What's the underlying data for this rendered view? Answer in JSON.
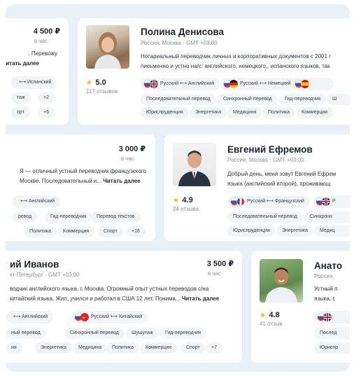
{
  "cards": [
    {
      "id": "partial-top-left",
      "price": "4 500 ₽",
      "per": "в час",
      "desc_lines": [
        ". Перевожу",
        "ь... Читать далее"
      ],
      "langs": [
        {
          "flags": [],
          "label": "⟷ Испанский"
        }
      ],
      "chips_row1": [
        "таж",
        "+2"
      ],
      "chips_row2": [
        "орт",
        "+6"
      ]
    },
    {
      "id": "polina",
      "name": "Полина Денисова",
      "location": "Россия, Москва · GMT +03:00",
      "desc_lines": [
        "Нотариальный переводчик личных и корпоративных документов с 2001 г",
        "письменно и устно на/с: английского, немецкого,, испанского языков, так"
      ],
      "rating": "5.0",
      "reviews": "117 отзывов",
      "langs": [
        {
          "flags": [
            "ru",
            "gb"
          ],
          "label": "Русский ⟷ Английский"
        },
        {
          "flags": [
            "ru",
            "de"
          ],
          "label": "Русский ⟷ Немецкий"
        },
        {
          "flags": [
            "ru",
            "es"
          ],
          "label": ""
        }
      ],
      "chips_row1": [
        "Последовательный перевод",
        "Синхронный перевод",
        "Гид-переводчик",
        "Ш"
      ],
      "chips_row2": [
        "Юриспруденция",
        "Энергетика",
        "Медицина",
        "Политика",
        "Коммерция"
      ]
    },
    {
      "id": "partial-middle-left",
      "price": "3 000 ₽",
      "per": "в час",
      "desc_lines": [
        "Я — отличный устный переводчик французского",
        "Москве. Последовательный и... Читать далее"
      ],
      "langs": [
        {
          "flags": [],
          "label": "⟷ Английский"
        }
      ],
      "chips_row1": [
        "ревод",
        "Гид-переводчик",
        "Перевод текстов"
      ],
      "chips_row2": [
        "Политика",
        "Коммерция",
        "Спорт",
        "+16"
      ]
    },
    {
      "id": "evgeny",
      "name": "Евгений Ефремов",
      "location": "Россия, Москва · GMT +03:00",
      "desc_lines": [
        "Добрый день, меня зовут Евгений Ефрем",
        "языка (английский второй), проживающ"
      ],
      "rating": "4.9",
      "reviews": "24 отзыва",
      "langs": [
        {
          "flags": [
            "ru",
            "fr"
          ],
          "label": "Русский ⟷ Французский"
        },
        {
          "flags": [
            "ru",
            "gb"
          ],
          "label": "Р"
        }
      ],
      "chips_row1": [
        "Последовательный перевод",
        "Синхронн"
      ],
      "chips_row2": [
        "Юриспруденция",
        "Энергетика",
        "Медиц"
      ]
    },
    {
      "id": "ivanov",
      "name": "ий Иванов",
      "location": "кт-Петербург · GMT +03:00",
      "price": "3 500 ₽",
      "per": "в час",
      "desc_lines": [
        "водчик английского языка, г. Москва. Огромный опыт устных переводов с/на",
        "китайский языка. Жил, учился и работал в США 12 лет. Понима... Читать далее"
      ],
      "langs": [
        {
          "flags": [],
          "label": "⟷ Английский"
        },
        {
          "flags": [
            "ru",
            "cn"
          ],
          "label": "Русский ⟷ Китайский"
        }
      ],
      "chips_row1": [
        "ный перевод",
        "Синхронный перевод",
        "Шушутаж",
        "Гид-переводчик"
      ],
      "chips_row2": [
        "ия",
        "Энергетика",
        "Медицина",
        "Политика",
        "Коммерция",
        "Спорт",
        "+7"
      ]
    },
    {
      "id": "anatoly",
      "name": "Анато",
      "location": "Россия, ",
      "desc_lines": [
        "Устный п",
        "языка, г."
      ],
      "rating": "4.8",
      "reviews": "41 отзыв",
      "langs": [
        {
          "flags": [
            "ru",
            "gb"
          ],
          "label": ""
        }
      ],
      "chips_row1": [
        "Послед"
      ],
      "chips_row2": [
        "Юриспр"
      ]
    }
  ],
  "more_label": "Читать далее",
  "icons": {
    "rating": "star-icon"
  }
}
